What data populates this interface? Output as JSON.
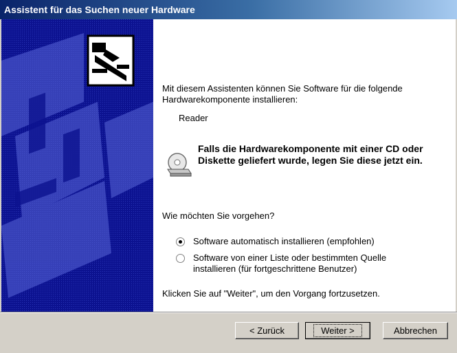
{
  "window": {
    "title": "Assistent für das Suchen neuer Hardware"
  },
  "sidepanel": {
    "icon": "hardware-card-icon"
  },
  "main": {
    "intro": "Mit diesem Assistenten können Sie Software für die folgende Hardwarekomponente installieren:",
    "device_name": "Reader",
    "cd_icon": "cd-drive-icon",
    "cd_notice": "Falls die Hardwarekomponente mit einer CD oder Diskette geliefert wurde, legen Sie diese jetzt ein.",
    "question": "Wie möchten Sie vorgehen?",
    "options": [
      {
        "label": "Software automatisch installieren (empfohlen)",
        "selected": true
      },
      {
        "label": "Software von einer Liste oder bestimmten Quelle installieren (für fortgeschrittene Benutzer)",
        "selected": false
      }
    ],
    "hint": "Klicken Sie auf \"Weiter\", um den Vorgang fortzusetzen."
  },
  "buttons": {
    "back": "< Zurück",
    "next": "Weiter >",
    "cancel": "Abbrechen"
  },
  "colors": {
    "title_start": "#0a246a",
    "title_end": "#a6caf0",
    "panel": "#0c1290",
    "dialog_bg": "#d4d0c8"
  }
}
